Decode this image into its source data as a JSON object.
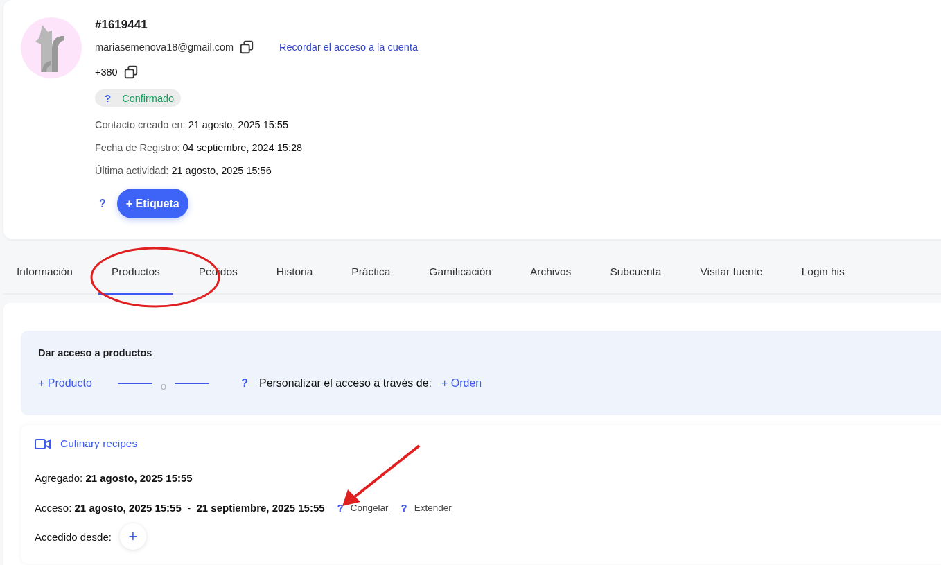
{
  "profile": {
    "id": "#1619441",
    "email": "mariasemenova18@gmail.com",
    "remind_link": "Recordar el acceso a la cuenta",
    "phone": "+380",
    "status": {
      "help": "?",
      "label": "Confirmado"
    },
    "facts": [
      {
        "label": "Contacto creado en:",
        "value": "21 agosto, 2025 15:55"
      },
      {
        "label": "Fecha de Registro:",
        "value": "04 septiembre, 2024 15:28"
      },
      {
        "label": "Última actividad:",
        "value": "21 agosto, 2025 15:56"
      }
    ],
    "tag_help": "?",
    "tag_button": "+ Etiqueta"
  },
  "tabs": [
    {
      "label": "Información",
      "selected": false
    },
    {
      "label": "Productos",
      "selected": true
    },
    {
      "label": "Pedidos",
      "selected": false
    },
    {
      "label": "Historia",
      "selected": false
    },
    {
      "label": "Práctica",
      "selected": false
    },
    {
      "label": "Gamificación",
      "selected": false
    },
    {
      "label": "Archivos",
      "selected": false
    },
    {
      "label": "Subcuenta",
      "selected": false
    },
    {
      "label": "Visitar fuente",
      "selected": false
    },
    {
      "label": "Login his",
      "selected": false
    }
  ],
  "grant": {
    "title": "Dar acceso a productos",
    "add_product": "+ Producto",
    "or": "o",
    "help": "?",
    "custom_label": "Personalizar el acceso a través de:",
    "add_order": "+ Orden"
  },
  "product": {
    "name": "Culinary recipes",
    "added_label": "Agregado:",
    "added_value": "21 agosto, 2025 15:55",
    "access_label": "Acceso:",
    "access_from": "21 agosto, 2025 15:55",
    "access_sep": "-",
    "access_to": "21 septiembre, 2025 15:55",
    "actions": [
      {
        "help": "?",
        "label": "Congelar"
      },
      {
        "help": "?",
        "label": "Extender"
      }
    ],
    "from_label": "Accedido desde:",
    "from_button": "+"
  }
}
